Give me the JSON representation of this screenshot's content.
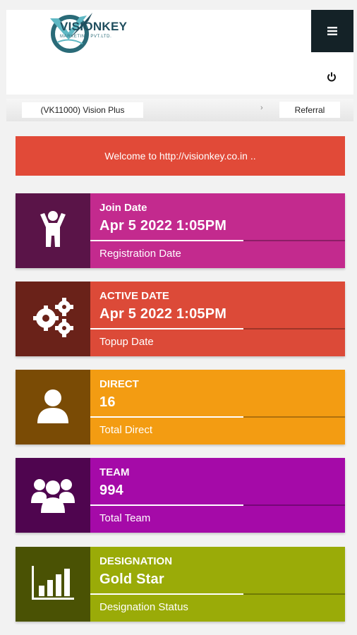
{
  "header": {
    "brand": "VISIONKEY",
    "tagline": "MARKETING PVT.LTD.",
    "menu_icon": "hamburger-icon",
    "power_icon": "power-icon",
    "colors": {
      "menu_bg": "#142227",
      "brand": "#1f4e5e"
    }
  },
  "topbar": {
    "account": "(VK11000) Vision Plus",
    "referral": "Referral",
    "arrow": "›"
  },
  "welcome": {
    "text": "Welcome to http://visionkey.co.in ..",
    "color": "#e14a38"
  },
  "cards": [
    {
      "label": "Join Date",
      "value": "Apr 5 2022 1:05PM",
      "desc": "Registration Date",
      "icon": "person-icon",
      "color": "#c32a8e",
      "icon_bg": "#5a1448",
      "progress": 0.6
    },
    {
      "label": "ACTIVE DATE",
      "value": "Apr 5 2022 1:05PM",
      "desc": "Topup Date",
      "icon": "gears-icon",
      "color": "#dc4a38",
      "icon_bg": "#6a2219",
      "progress": 0.6
    },
    {
      "label": "DIRECT",
      "value": "16",
      "desc": "Total Direct",
      "icon": "user-icon",
      "color": "#f39c12",
      "icon_bg": "#7a4b05",
      "progress": 0.6
    },
    {
      "label": "TEAM",
      "value": "994",
      "desc": "Total Team",
      "icon": "group-icon",
      "color": "#a50aa8",
      "icon_bg": "#4f054f",
      "progress": 0.6
    },
    {
      "label": "DESIGNATION",
      "value": "Gold Star",
      "desc": "Designation Status",
      "icon": "bar-chart-icon",
      "color": "#9aab08",
      "icon_bg": "#4a5204",
      "progress": 0.6
    }
  ]
}
